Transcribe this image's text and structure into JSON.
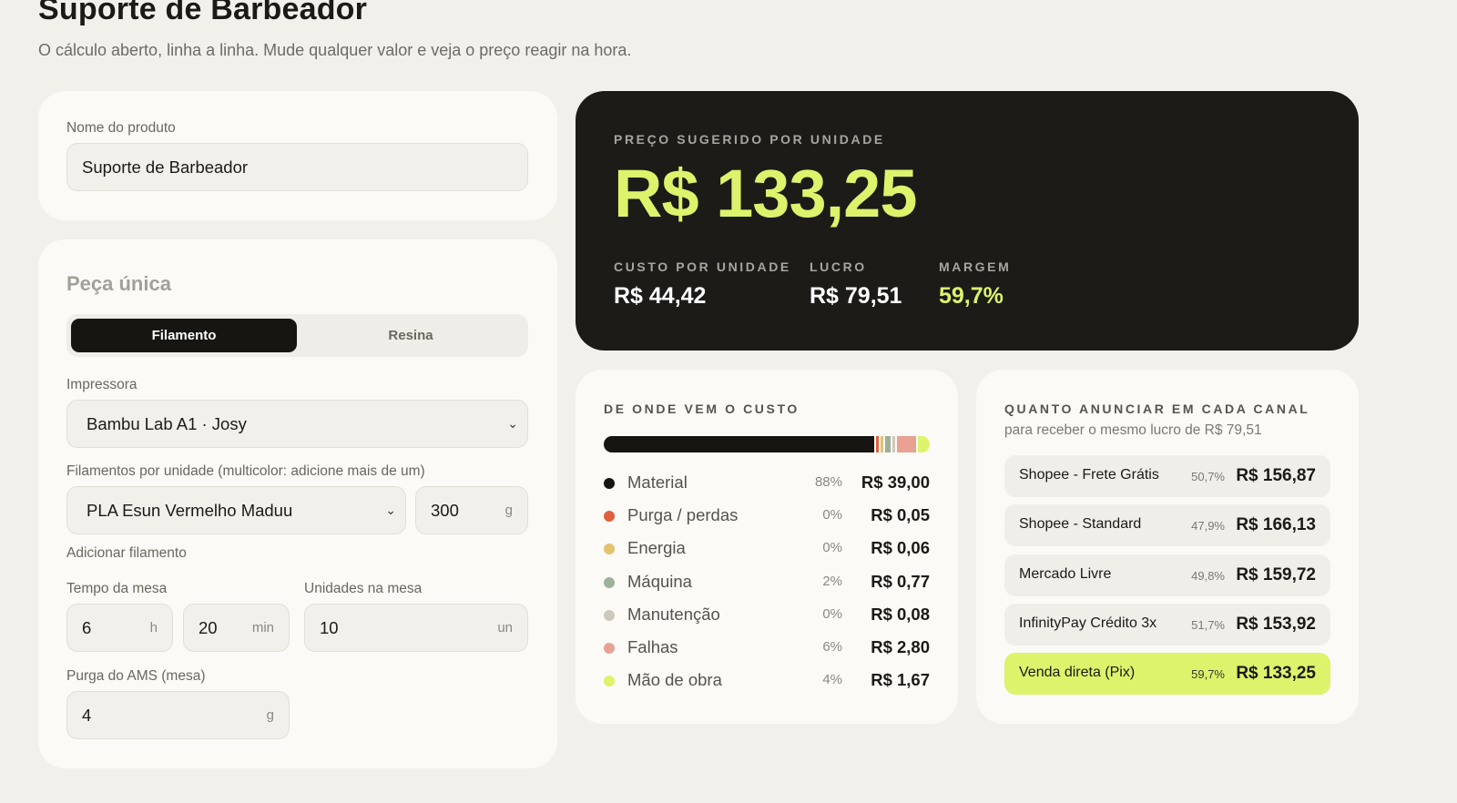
{
  "header": {
    "title": "Suporte de Barbeador",
    "subtitle": "O cálculo aberto, linha a linha. Mude qualquer valor e veja o preço reagir na hora."
  },
  "product": {
    "name_label": "Nome do produto",
    "name_value": "Suporte de Barbeador"
  },
  "piece": {
    "section_title": "Peça única",
    "tabs": [
      {
        "label": "Filamento",
        "active": true
      },
      {
        "label": "Resina",
        "active": false
      }
    ],
    "printer_label": "Impressora",
    "printer_value": "Bambu Lab A1 · Josy",
    "filaments_label": "Filamentos por unidade (multicolor: adicione mais de um)",
    "filament_value": "PLA Esun Vermelho Maduu",
    "filament_grams": "300",
    "filament_grams_unit": "g",
    "add_filament_label": "Adicionar filamento",
    "table_time_label": "Tempo da mesa",
    "hours_value": "6",
    "hours_unit": "h",
    "minutes_value": "20",
    "minutes_unit": "min",
    "units_label": "Unidades na mesa",
    "units_value": "10",
    "units_unit": "un",
    "ams_purge_label": "Purga do AMS (mesa)",
    "ams_purge_value": "4",
    "ams_purge_unit": "g"
  },
  "price": {
    "overline": "PREÇO SUGERIDO POR UNIDADE",
    "value": "R$ 133,25",
    "stats": [
      {
        "label": "CUSTO POR UNIDADE",
        "value": "R$ 44,42"
      },
      {
        "label": "LUCRO",
        "value": "R$ 79,51"
      },
      {
        "label": "MARGEM",
        "value": "59,7%"
      }
    ],
    "accent_color": "#dcf36b"
  },
  "cost": {
    "title": "DE ONDE VEM O CUSTO",
    "items": [
      {
        "name": "Material",
        "pct": "88%",
        "amount": "R$ 39,00",
        "share": 0.878,
        "color": "#161512"
      },
      {
        "name": "Purga / perdas",
        "pct": "0%",
        "amount": "R$ 0,05",
        "share": 0.001,
        "color": "#e0613e"
      },
      {
        "name": "Energia",
        "pct": "0%",
        "amount": "R$ 0,06",
        "share": 0.001,
        "color": "#e3c36b"
      },
      {
        "name": "Máquina",
        "pct": "2%",
        "amount": "R$ 0,77",
        "share": 0.017,
        "color": "#9fb09a"
      },
      {
        "name": "Manutenção",
        "pct": "0%",
        "amount": "R$ 0,08",
        "share": 0.002,
        "color": "#cfc8bd"
      },
      {
        "name": "Falhas",
        "pct": "6%",
        "amount": "R$ 2,80",
        "share": 0.063,
        "color": "#e8a192"
      },
      {
        "name": "Mão de obra",
        "pct": "4%",
        "amount": "R$ 1,67",
        "share": 0.038,
        "color": "#dcf36b"
      }
    ]
  },
  "channels": {
    "title": "QUANTO ANUNCIAR EM CADA CANAL",
    "subtitle": "para receber o mesmo lucro de R$ 79,51",
    "items": [
      {
        "name": "Shopee - Frete Grátis",
        "pct": "50,7%",
        "price": "R$ 156,87",
        "highlight": false
      },
      {
        "name": "Shopee - Standard",
        "pct": "47,9%",
        "price": "R$ 166,13",
        "highlight": false
      },
      {
        "name": "Mercado Livre",
        "pct": "49,8%",
        "price": "R$ 159,72",
        "highlight": false
      },
      {
        "name": "InfinityPay Crédito 3x",
        "pct": "51,7%",
        "price": "R$ 153,92",
        "highlight": false
      },
      {
        "name": "Venda direta (Pix)",
        "pct": "59,7%",
        "price": "R$ 133,25",
        "highlight": true
      }
    ]
  }
}
